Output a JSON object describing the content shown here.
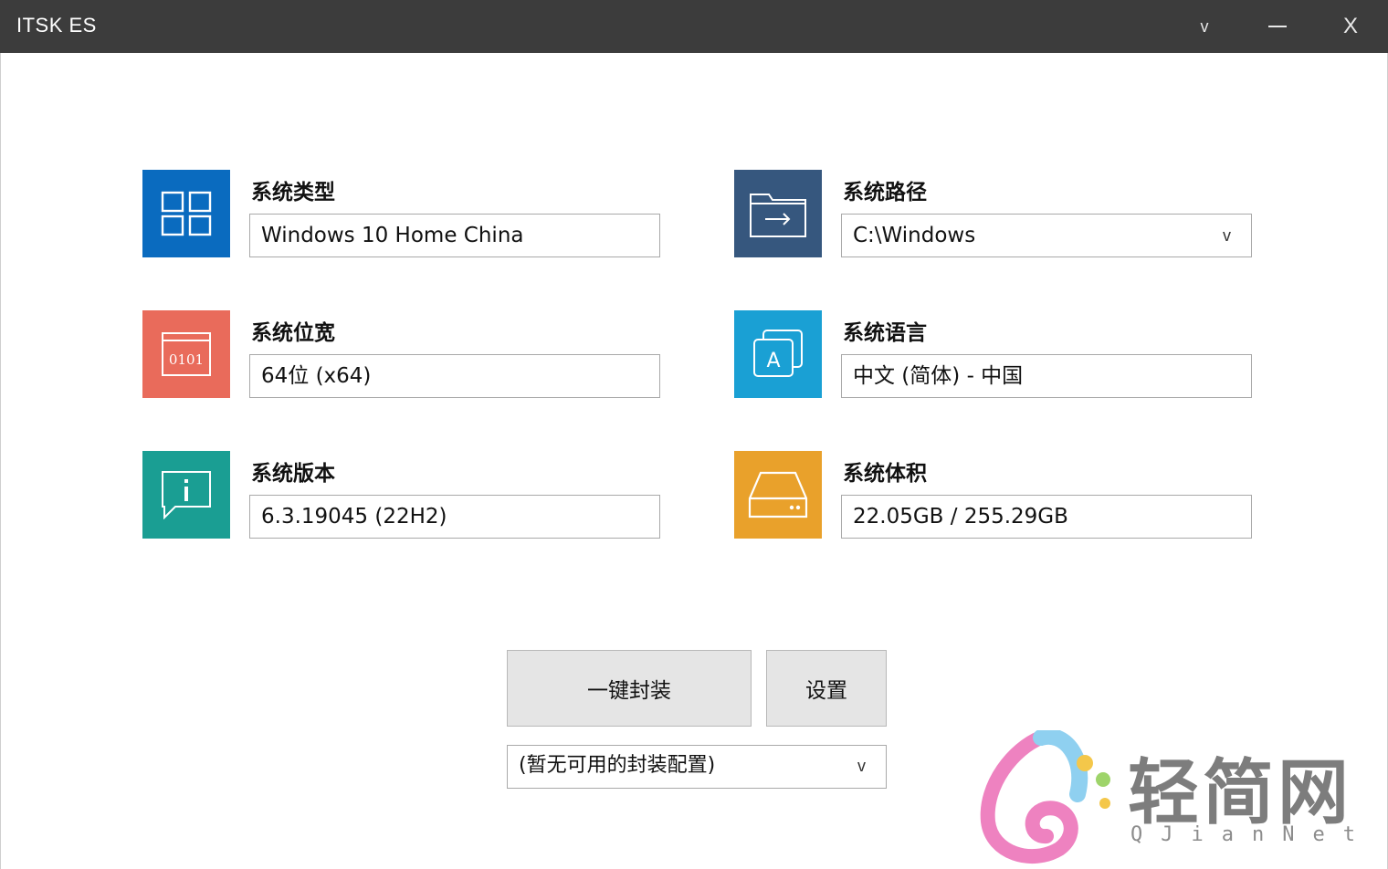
{
  "window": {
    "title": "ITSK ES",
    "menu_icon": "chevron-down-icon",
    "menu_glyph": "v",
    "min_icon": "minimize-icon",
    "close_icon": "close-icon",
    "close_glyph": "X"
  },
  "info": [
    {
      "label": "系统类型",
      "value": "Windows 10 Home China",
      "color": "#0a6bbf",
      "icon": "windows-icon"
    },
    {
      "label": "系统路径",
      "value": "C:\\Windows",
      "color": "#36577e",
      "icon": "folder-arrow-icon",
      "dropdown": true
    },
    {
      "label": "系统位宽",
      "value": "64位 (x64)",
      "color": "#e96b5b",
      "icon": "binary-window-icon"
    },
    {
      "label": "系统语言",
      "value": "中文 (简体) - 中国",
      "color": "#1aa0d4",
      "icon": "language-icon"
    },
    {
      "label": "系统版本",
      "value": "6.3.19045 (22H2)",
      "color": "#1a9e93",
      "icon": "info-icon"
    },
    {
      "label": "系统体积",
      "value": "22.05GB / 255.29GB",
      "color": "#e9a12b",
      "icon": "drive-icon"
    }
  ],
  "dropdown_glyph": "v",
  "actions": {
    "package_label": "一键封装",
    "settings_label": "设置",
    "config_select": "(暂无可用的封装配置)"
  },
  "watermark": {
    "text": "轻简网",
    "sub": "QJianNet"
  }
}
